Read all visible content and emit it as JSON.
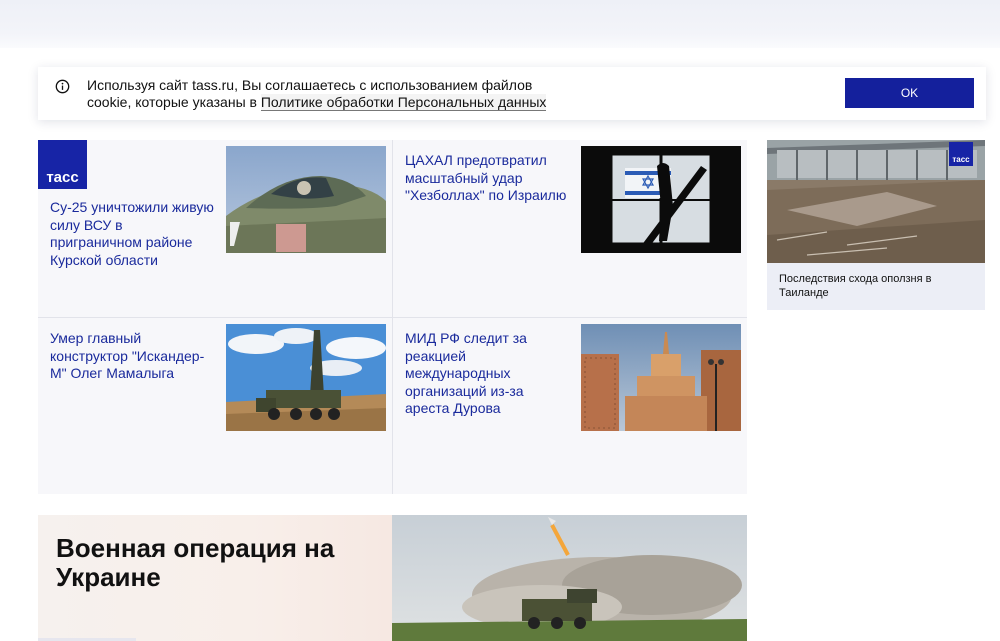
{
  "cookie_banner": {
    "text_before_link": "Используя сайт tass.ru, Вы соглашаетесь с использованием файлов cookie, которые указаны в ",
    "link_text": "Политике обработки Персональных данных",
    "ok_label": "OK",
    "icon": "info-icon"
  },
  "logo": {
    "text": "тасс"
  },
  "news": [
    {
      "title": "Су-25 уничтожили живую силу ВСУ в приграничном районе Курской области",
      "image": "su25-jet-cockpit"
    },
    {
      "title": "ЦАХАЛ предотвратил масштабный удар \"Хезболлах\" по Израилю",
      "image": "silhouette-israel-flag"
    },
    {
      "title": "Умер главный конструктор \"Искандер-М\" Олег Мамалыга",
      "image": "iskander-launcher"
    },
    {
      "title": "МИД РФ следит за реакцией международных организаций из-за ареста Дурова",
      "image": "mfa-building-moscow"
    }
  ],
  "side_card": {
    "logo_text": "тасс",
    "title": "Последствия схода оползня в Таиланде",
    "image": "landslide-debris"
  },
  "promo": {
    "title": "Военная операция на Украине",
    "image": "rocket-launch-field"
  },
  "colors": {
    "brand_blue": "#14209c",
    "link_blue": "#1a2a9c",
    "grid_bg": "#f7f7fa"
  }
}
